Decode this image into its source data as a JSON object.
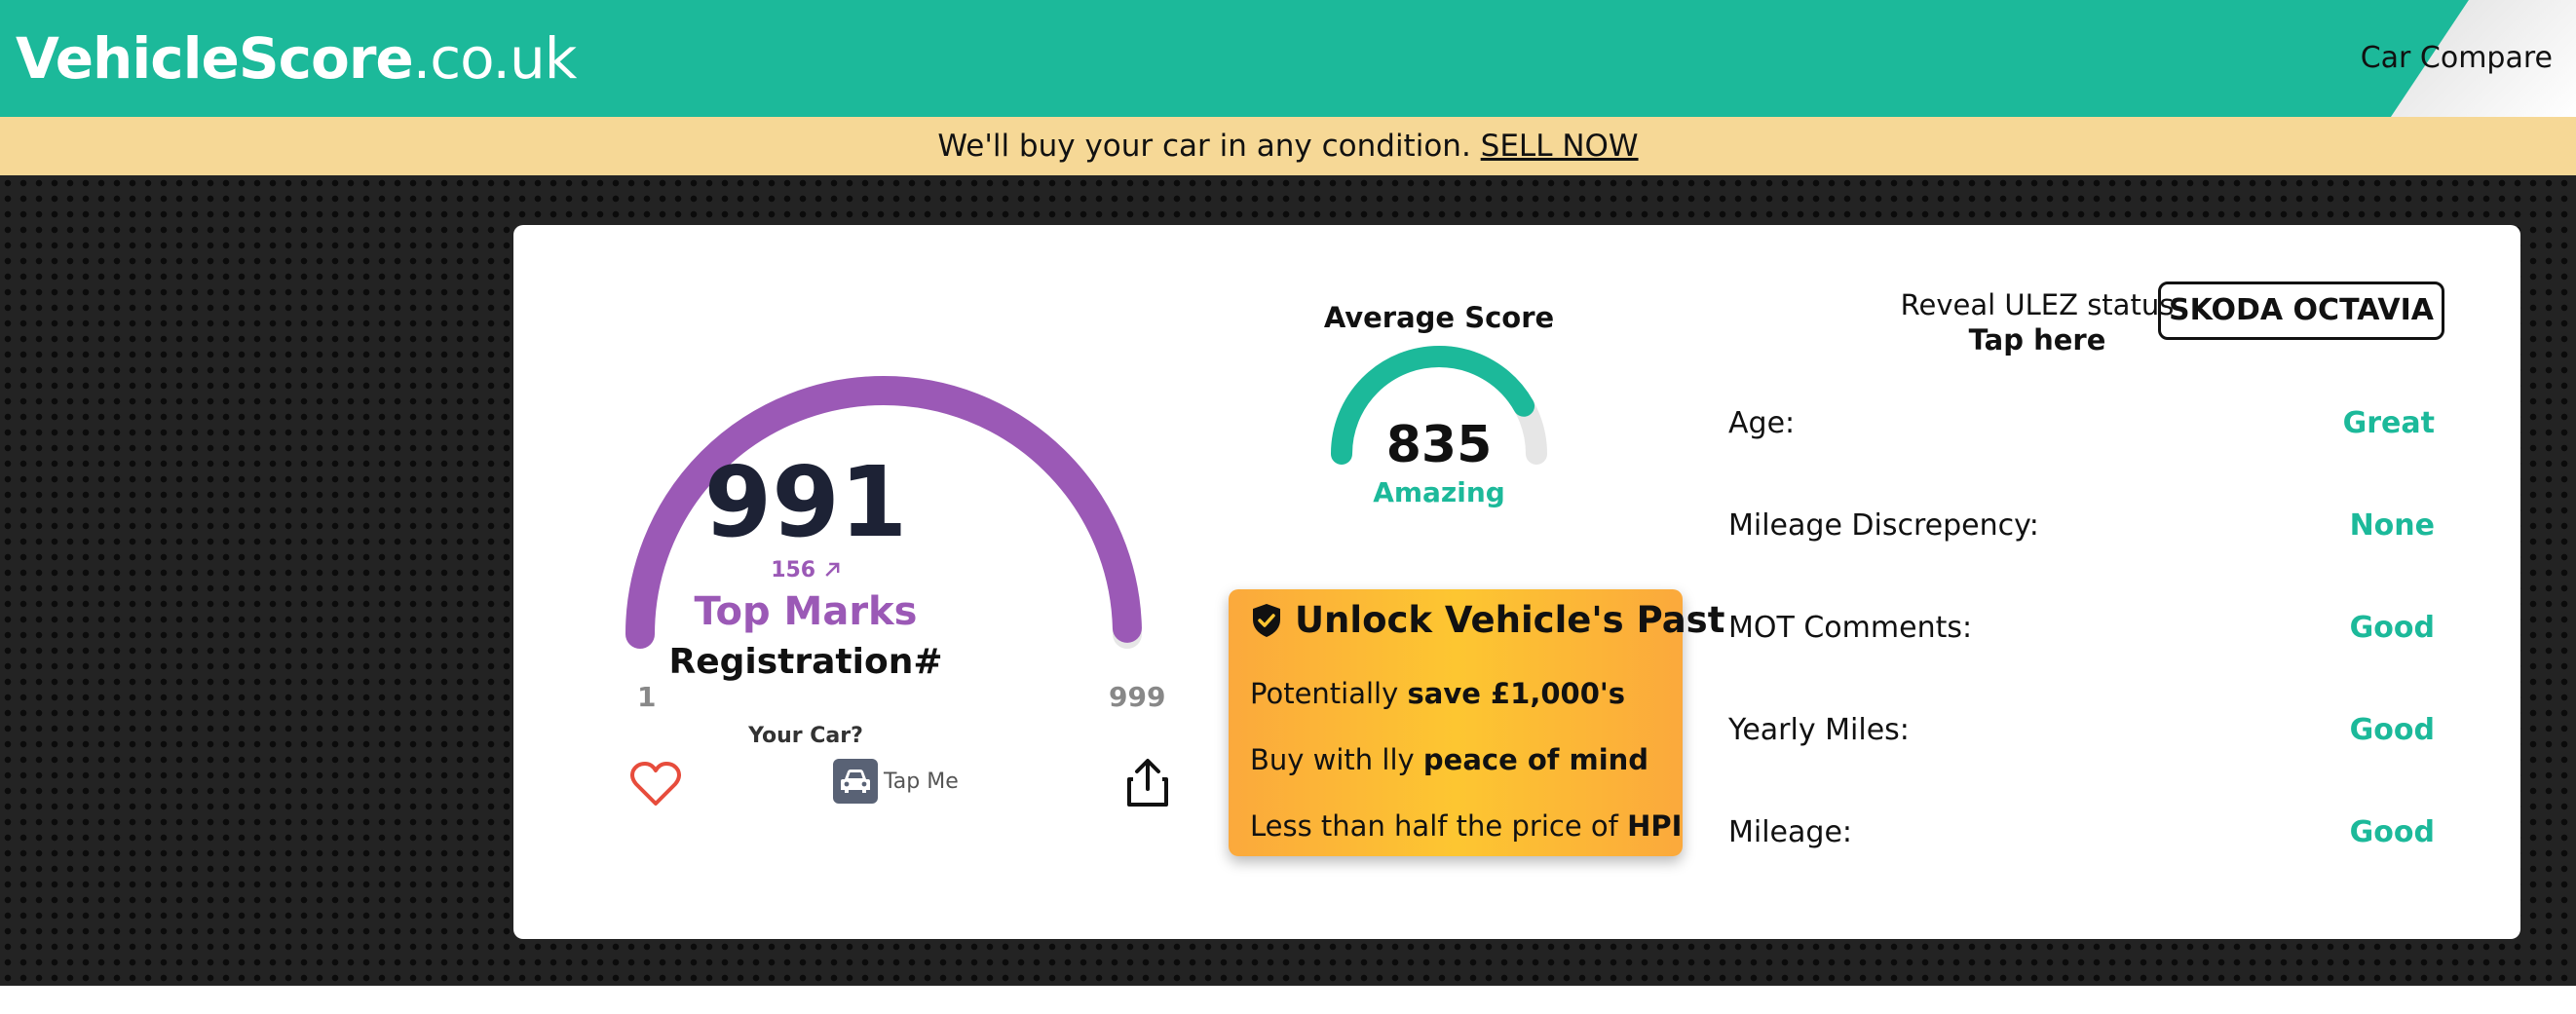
{
  "header": {
    "logo_brand": "VehicleScore",
    "logo_tld": ".co.uk",
    "nav_compare": "Car Compare"
  },
  "banner": {
    "text": "We'll buy your car in any condition. ",
    "link": "SELL NOW"
  },
  "score_card": {
    "score": "991",
    "score_value": 991,
    "range_min": "1",
    "range_max": "999",
    "delta": "156",
    "grade": "Top Marks",
    "registration": "Registration#",
    "your_car": "Your Car?",
    "tap_me": "Tap Me",
    "gauge_color": "#9b59b6"
  },
  "average": {
    "title": "Average Score",
    "score": "835",
    "score_value": 835,
    "grade": "Amazing",
    "gauge_color": "#1cb99a"
  },
  "unlock": {
    "title": "Unlock Vehicle's Past",
    "line1_pre": "Potentially ",
    "line1_bold": "save £1,000's",
    "line2_pre": "Buy with lly ",
    "line2_bold": "peace of mind",
    "line3_pre": "Less than half the price of ",
    "line3_bold": "HPI"
  },
  "ulez": {
    "line1": "Reveal ULEZ status",
    "line2": "Tap here"
  },
  "vehicle": {
    "make_model": "SKODA OCTAVIA"
  },
  "stats": [
    {
      "label": "Age:",
      "value": "Great"
    },
    {
      "label": "Mileage Discrepency:",
      "value": "None"
    },
    {
      "label": "MOT Comments:",
      "value": "Good"
    },
    {
      "label": "Yearly Miles:",
      "value": "Good"
    },
    {
      "label": "Mileage:",
      "value": "Good"
    }
  ],
  "colors": {
    "brand_teal": "#1cb99a",
    "banner_yellow": "#f6d896",
    "accent_purple": "#9b59b6",
    "unlock_orange": "#fba93c"
  }
}
